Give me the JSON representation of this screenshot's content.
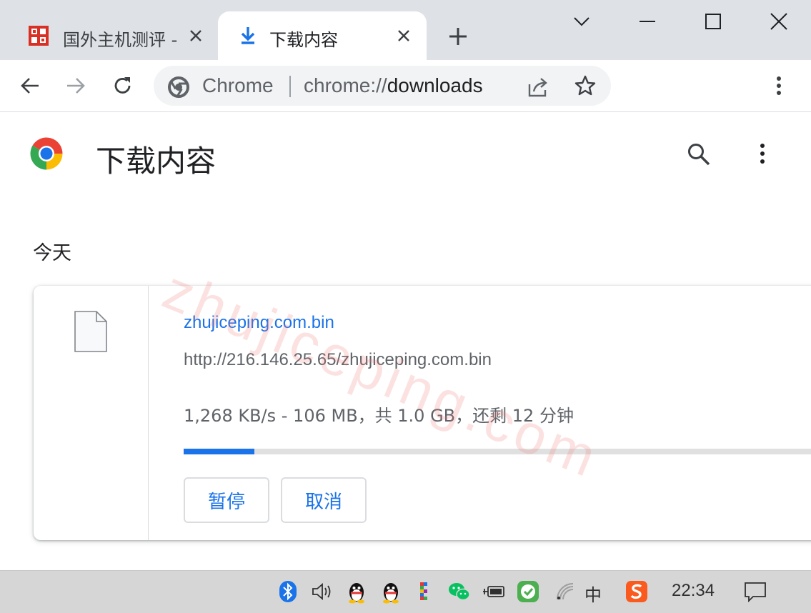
{
  "tabs": [
    {
      "title": "国外主机测评 -",
      "favicon": "site-seal-icon",
      "active": false
    },
    {
      "title": "下载内容",
      "favicon": "download-arrow-icon",
      "active": true
    }
  ],
  "toolbar": {
    "chip_label": "Chrome",
    "url_scheme": "chrome://",
    "url_host": "downloads"
  },
  "page": {
    "title": "下载内容",
    "watermark": "zhujiceping.com",
    "date_group": "今天"
  },
  "download": {
    "file_name": "zhujiceping.com.bin",
    "url": "http://216.146.25.65/zhujiceping.com.bin",
    "status": "1,268 KB/s - 106 MB，共 1.0 GB，还剩 12 分钟",
    "progress_fraction": 0.11,
    "pause_label": "暂停",
    "cancel_label": "取消"
  },
  "taskbar": {
    "ime_label": "中",
    "clock": "22:34",
    "icons": [
      "bluetooth-icon",
      "volume-icon",
      "qq-icon",
      "qq-icon",
      "colorful-app-icon",
      "wechat-icon",
      "battery-icon",
      "security-check-icon",
      "wifi-icon",
      "sogou-ime-icon",
      "notification-icon"
    ]
  },
  "colors": {
    "accent": "#1a73e8",
    "tabstrip": "#dee1e6",
    "omnibox": "#f1f3f4",
    "text_primary": "#202124",
    "text_secondary": "#5f6368"
  }
}
